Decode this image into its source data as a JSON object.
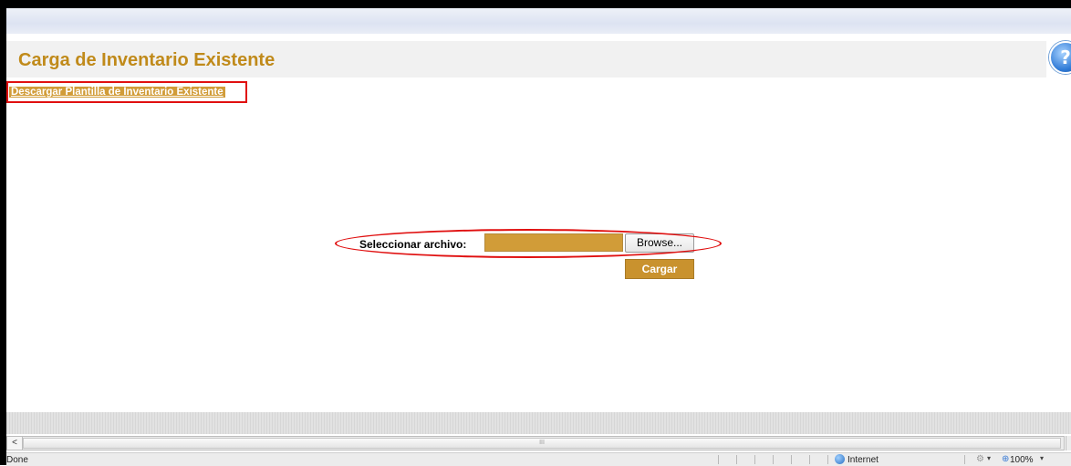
{
  "header": {
    "title": "Carga de Inventario Existente",
    "help_glyph": "?"
  },
  "download_link": {
    "label": "Descargar Plantilla de Inventario Existente"
  },
  "upload": {
    "file_label": "Seleccionar archivo:",
    "file_value": "",
    "browse_label": "Browse...",
    "submit_label": "Cargar"
  },
  "scrollbar": {
    "left_arrow": "<",
    "thumb_grip": "III"
  },
  "statusbar": {
    "status": "Done",
    "zone": "Internet",
    "zoom": "100%",
    "dropdown_arrow": "▾"
  },
  "colors": {
    "accent": "#d19c38",
    "title": "#c08a1a",
    "highlight": "#e01010"
  },
  "icons": {
    "help": "help-icon",
    "globe": "globe-icon",
    "lock": "lock-icon",
    "zoom": "zoom-icon"
  }
}
